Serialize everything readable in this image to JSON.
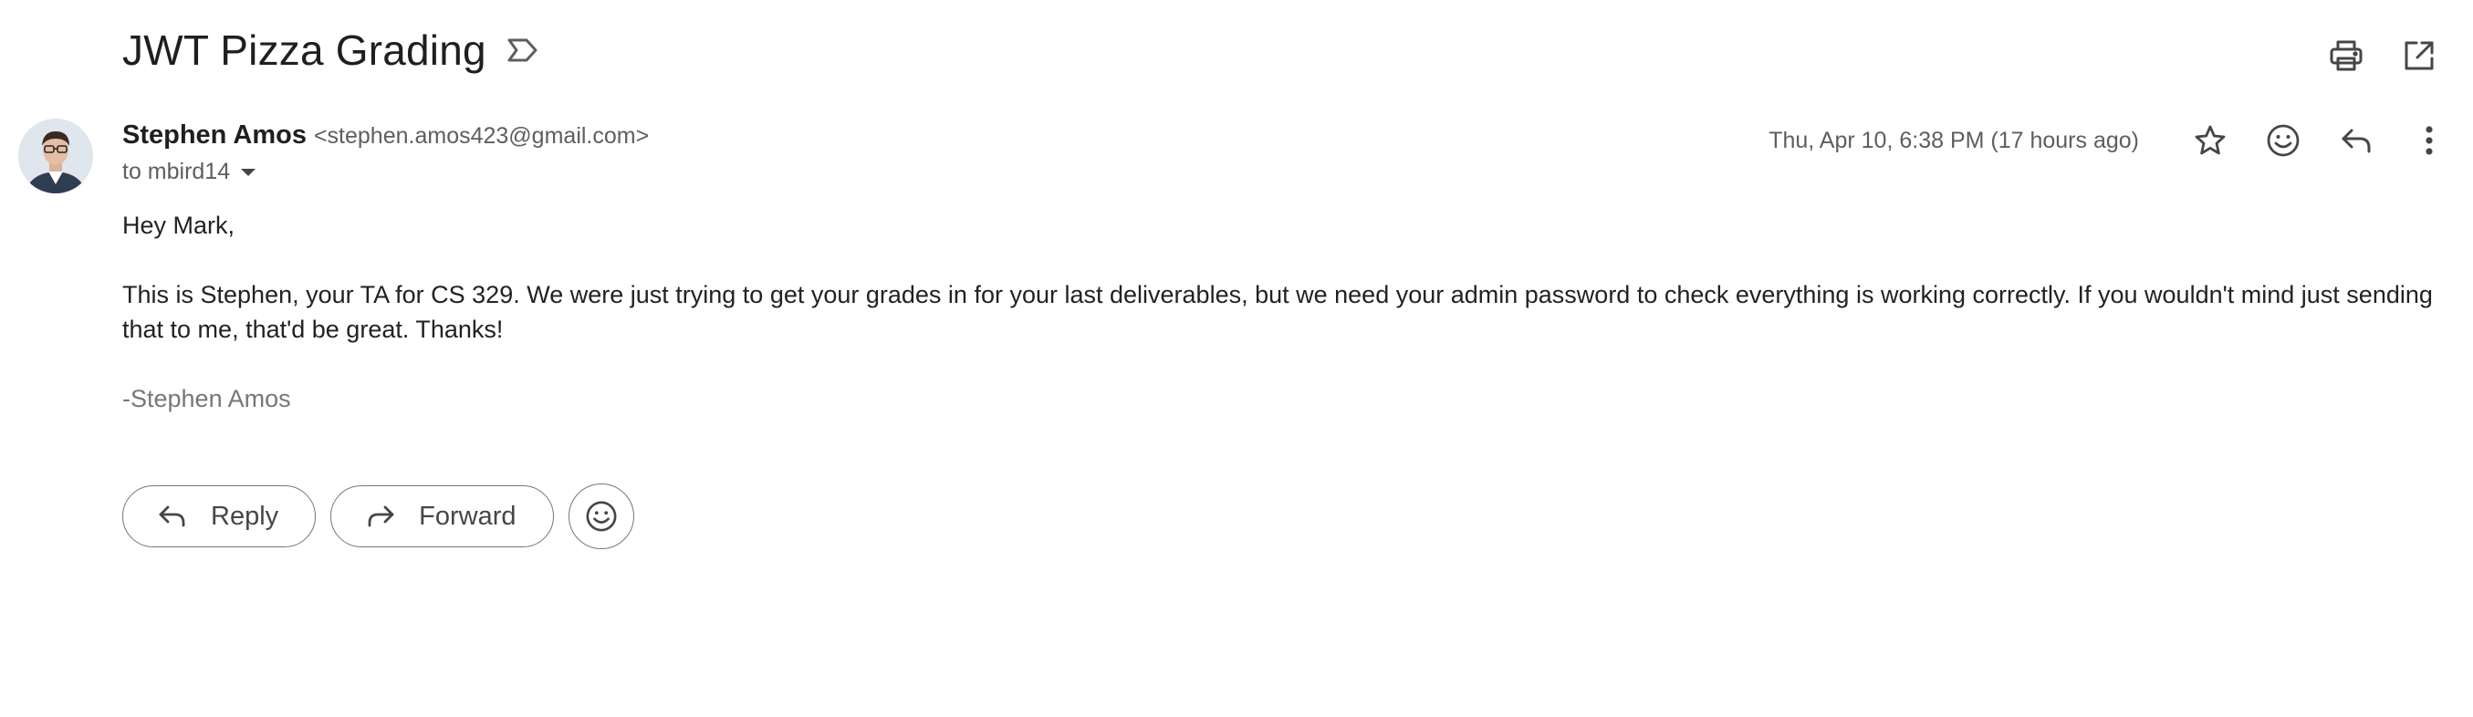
{
  "email": {
    "subject": "JWT Pizza Grading",
    "sender_name": "Stephen Amos",
    "sender_email": "<stephen.amos423@gmail.com>",
    "to_text": "to mbird14",
    "date": "Thu, Apr 10, 6:38 PM (17 hours ago)",
    "body": {
      "greeting": "Hey Mark,",
      "paragraph": "This is Stephen, your TA for CS 329. We were just trying to get your grades in for your last deliverables, but we need your admin password to check everything is working correctly. If you wouldn't mind just sending that to me, that'd be great. Thanks!",
      "signature": "-Stephen Amos"
    }
  },
  "actions": {
    "reply_label": "Reply",
    "forward_label": "Forward"
  },
  "icons": {
    "label": "label-outline-icon",
    "print": "print-icon",
    "open_new_window": "open-in-new-icon",
    "star": "star-outline-icon",
    "emoji": "emoji-icon",
    "reply": "reply-icon",
    "more": "more-vertical-icon",
    "forward": "forward-icon"
  },
  "colors": {
    "text_primary": "#1f1f1f",
    "text_secondary": "#5e5e5e",
    "signature": "#777777",
    "button_border": "#747775"
  }
}
